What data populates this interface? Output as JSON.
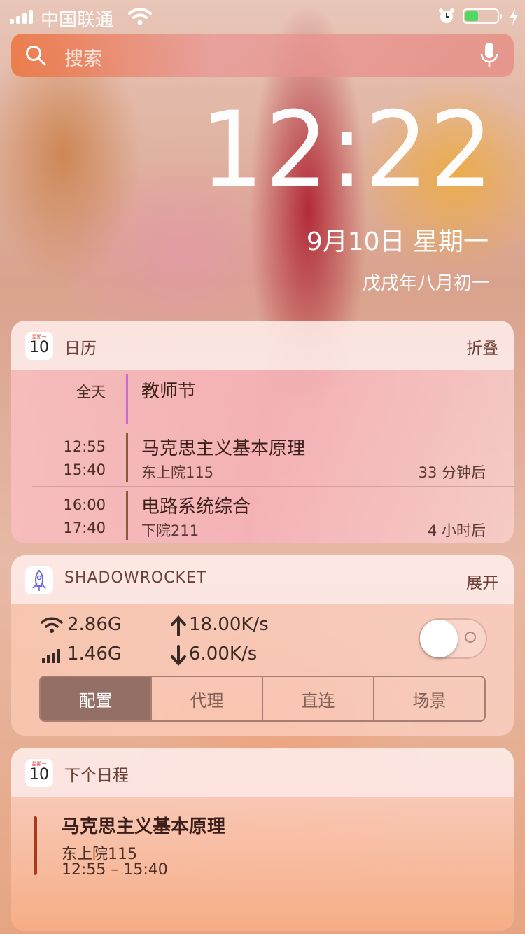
{
  "status_bar": {
    "carrier": "中国联通",
    "battery_level": 0.35,
    "accent_battery": "#4cd964"
  },
  "search": {
    "placeholder": "搜索"
  },
  "lockscreen": {
    "time": "12:22",
    "date": "9月10日 星期一",
    "lunar_date": "戊戌年八月初一"
  },
  "calendar_widget": {
    "icon_weekday": "星期一",
    "icon_day": "10",
    "title": "日历",
    "action": "折叠",
    "events": [
      {
        "start": "全天",
        "end": "",
        "title": "教师节",
        "location": "",
        "relative": "",
        "bar_color": "#c86ad6"
      },
      {
        "start": "12:55",
        "end": "15:40",
        "title": "马克思主义基本原理",
        "location": "东上院115",
        "relative": "33 分钟后",
        "bar_color": "#8a5a3a"
      },
      {
        "start": "16:00",
        "end": "17:40",
        "title": "电路系统综合",
        "location": "下院211",
        "relative": "4 小时后",
        "bar_color": "#8a5a3a"
      }
    ]
  },
  "shadowrocket_widget": {
    "title": "SHADOWROCKET",
    "action": "展开",
    "wifi_usage": "2.86G",
    "cellular_usage": "1.46G",
    "upload_speed": "18.00K/s",
    "download_speed": "6.00K/s",
    "toggle_on": false,
    "segments": [
      "配置",
      "代理",
      "直连",
      "场景"
    ],
    "selected_segment": "配置"
  },
  "next_event_widget": {
    "icon_weekday": "星期一",
    "icon_day": "10",
    "title": "下个日程",
    "event_title": "马克思主义基本原理",
    "event_location": "东上院115",
    "event_time": "12:55 – 15:40"
  }
}
